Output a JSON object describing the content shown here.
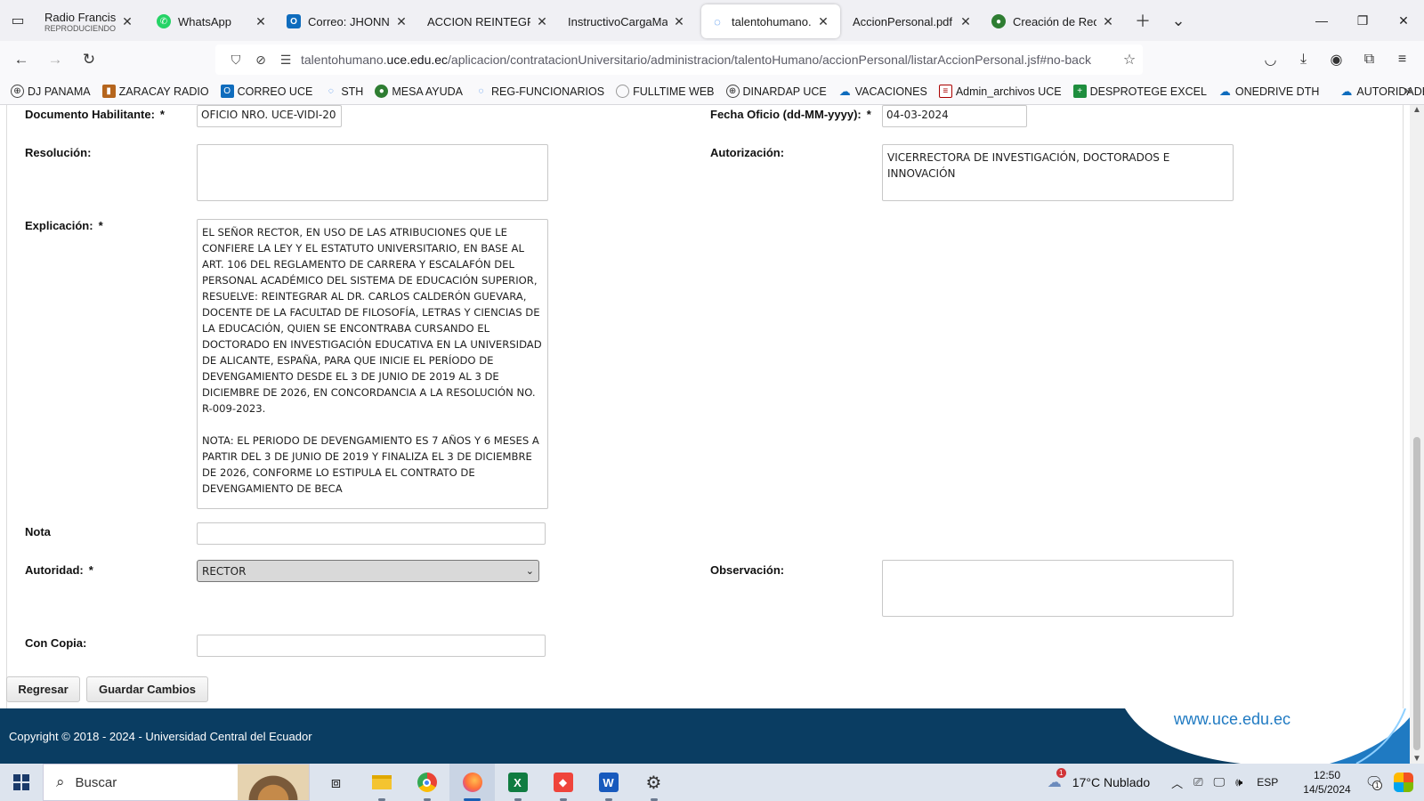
{
  "browser": {
    "tabs": [
      {
        "title": "Radio Francisco Es",
        "subtitle": "REPRODUCIENDO",
        "icon": "radio-icon",
        "active": false
      },
      {
        "title": "WhatsApp",
        "icon": "whatsapp-icon",
        "active": false
      },
      {
        "title": "Correo: JHONNY L",
        "icon": "outlook-icon",
        "active": false
      },
      {
        "title": "ACCION REINTEGRO F",
        "icon": "",
        "active": false
      },
      {
        "title": "InstructivoCargaMasiv",
        "icon": "",
        "active": false
      },
      {
        "title": "talentohumano.uc",
        "icon": "loading-icon",
        "active": true
      },
      {
        "title": "AccionPersonal.pdf",
        "icon": "",
        "active": false
      },
      {
        "title": "Creación de Requ",
        "icon": "uce-seal-icon",
        "active": false
      }
    ],
    "url_prefix": "talentohumano.",
    "url_domain": "uce.edu.ec",
    "url_path": "/aplicacion/contratacionUniversitario/administracion/talentoHumano/accionPersonal/listarAccionPersonal.jsf#no-back",
    "bookmarks": [
      {
        "label": "DJ PANAMA",
        "icon": "globe-icon"
      },
      {
        "label": "ZARACAY RADIO",
        "icon": "radio-icon"
      },
      {
        "label": "CORREO UCE",
        "icon": "outlook-icon"
      },
      {
        "label": "STH",
        "icon": "loading-icon"
      },
      {
        "label": "MESA AYUDA",
        "icon": "uce-seal-icon"
      },
      {
        "label": "REG-FUNCIONARIOS",
        "icon": "loading-icon"
      },
      {
        "label": "FULLTIME WEB",
        "icon": "circle-icon"
      },
      {
        "label": "DINARDAP UCE",
        "icon": "globe-icon"
      },
      {
        "label": "VACACIONES",
        "icon": "onedrive-icon"
      },
      {
        "label": "Admin_archivos UCE",
        "icon": "doc-icon"
      },
      {
        "label": "DESPROTEGE EXCEL",
        "icon": "plus-green-icon"
      },
      {
        "label": "ONEDRIVE DTH",
        "icon": "onedrive-icon"
      },
      {
        "label": "AUTORIDADES",
        "icon": "onedrive-icon"
      }
    ]
  },
  "form": {
    "documento_label": "Documento Habilitante:",
    "documento_value": "OFICIO NRO. UCE-VIDI-20",
    "fecha_label": "Fecha Oficio (dd-MM-yyyy):",
    "fecha_value": "04-03-2024",
    "resolucion_label": "Resolución:",
    "resolucion_value": "",
    "autorizacion_label": "Autorización:",
    "autorizacion_value": "VICERRECTORA DE INVESTIGACIÓN, DOCTORADOS E INNOVACIÓN",
    "explicacion_label": "Explicación:",
    "explicacion_value": "EL SEÑOR RECTOR, EN USO DE LAS ATRIBUCIONES QUE LE CONFIERE LA LEY Y EL ESTATUTO UNIVERSITARIO, EN BASE AL ART. 106 DEL REGLAMENTO DE CARRERA Y ESCALAFÓN DEL PERSONAL ACADÉMICO DEL SISTEMA DE EDUCACIÓN SUPERIOR, RESUELVE: REINTEGRAR AL DR. CARLOS CALDERÓN GUEVARA, DOCENTE DE LA FACULTAD DE FILOSOFÍA, LETRAS Y CIENCIAS DE LA EDUCACIÓN, QUIEN SE ENCONTRABA CURSANDO EL DOCTORADO EN INVESTIGACIÓN EDUCATIVA EN LA UNIVERSIDAD DE ALICANTE, ESPAÑA, PARA QUE INICIE EL PERÍODO DE DEVENGAMIENTO DESDE EL 3 DE JUNIO DE 2019 AL 3 DE DICIEMBRE DE 2026, EN CONCORDANCIA A LA RESOLUCIÓN NO. R-009-2023.\n\nNOTA: EL PERIODO DE DEVENGAMIENTO ES 7 AÑOS Y 6 MESES A PARTIR DEL 3 DE JUNIO DE 2019 Y FINALIZA EL 3 DE DICIEMBRE DE 2026, CONFORME LO ESTIPULA EL CONTRATO DE DEVENGAMIENTO DE BECA",
    "nota_label": "Nota",
    "nota_value": "",
    "autoridad_label": "Autoridad:",
    "autoridad_value": "RECTOR",
    "observacion_label": "Observación:",
    "observacion_value": "",
    "concopia_label": "Con Copia:",
    "concopia_value": "",
    "required_mark": "*"
  },
  "buttons": {
    "regresar": "Regresar",
    "guardar": "Guardar Cambios"
  },
  "footer": {
    "copyright": "Copyright © 2018 - 2024 - Universidad Central del Ecuador",
    "website": "www.uce.edu.ec"
  },
  "taskbar": {
    "search_placeholder": "Buscar",
    "weather": "17°C  Nublado",
    "weather_badge": "1",
    "language": "ESP",
    "time": "12:50",
    "date": "14/5/2024",
    "notification_count": "1"
  }
}
